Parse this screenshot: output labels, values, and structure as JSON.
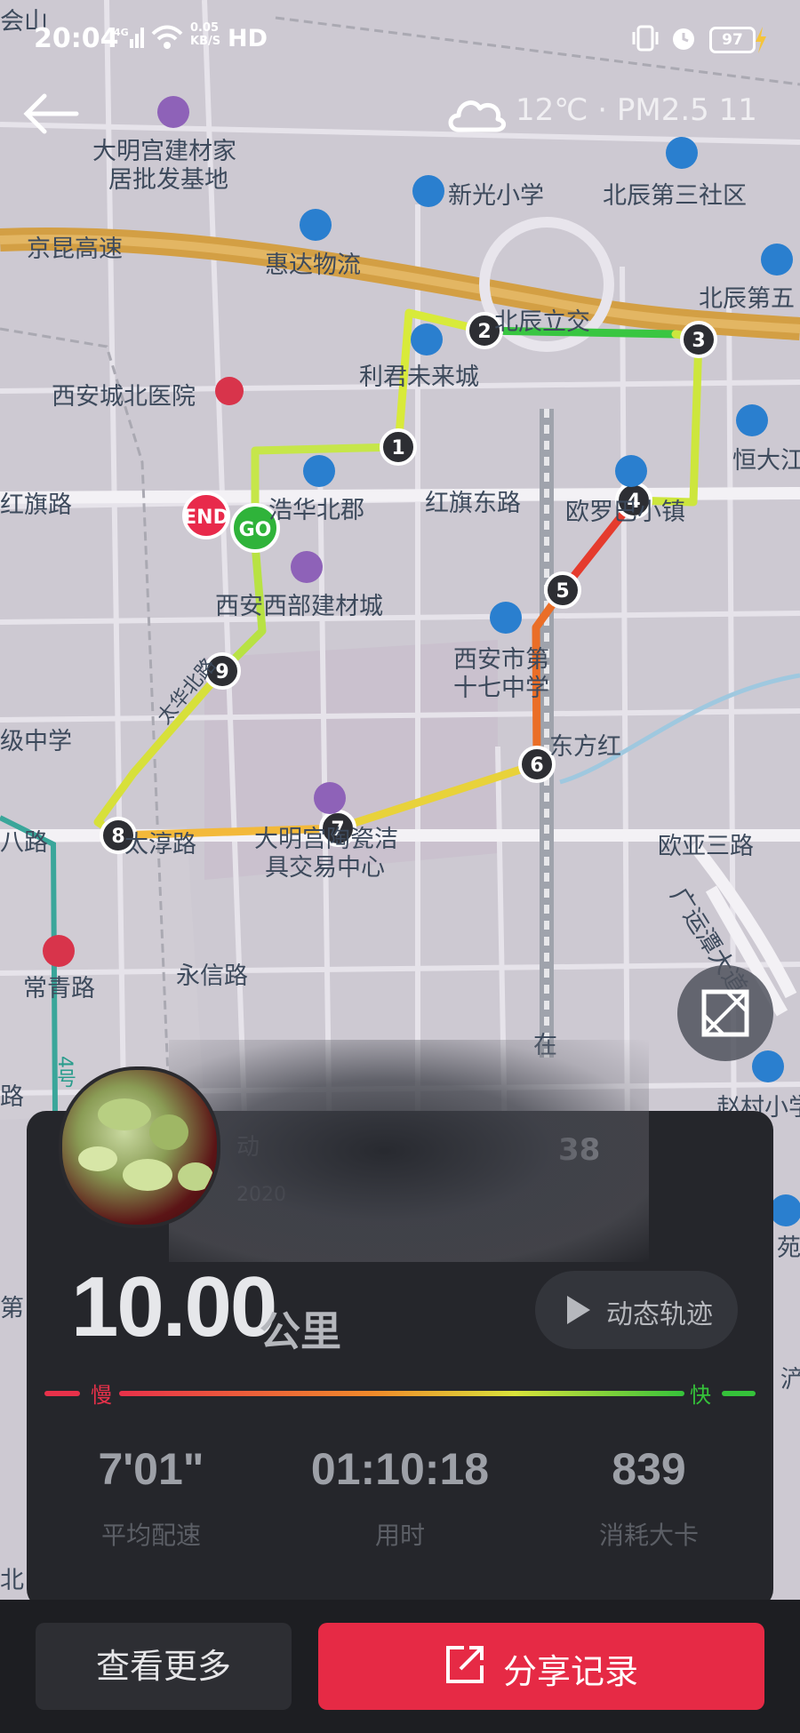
{
  "status_bar": {
    "time": "20:04",
    "network": "4G",
    "speed_value": "0.05",
    "speed_unit": "KB/S",
    "hd": "HD",
    "battery": "97"
  },
  "weather": {
    "text": "12℃ · PM2.5 11",
    "icon": "cloud-icon"
  },
  "map": {
    "labels": [
      {
        "id": "huishan",
        "text": "会山"
      },
      {
        "id": "daminggong-building",
        "text": "大明宫建材家"
      },
      {
        "id": "daminggong-building-2",
        "text": "居批发基地"
      },
      {
        "id": "xinguang",
        "text": "新光小学"
      },
      {
        "id": "beichen3",
        "text": "北辰第三社区"
      },
      {
        "id": "jingkun",
        "text": "京昆高速"
      },
      {
        "id": "huida",
        "text": "惠达物流"
      },
      {
        "id": "beichen5",
        "text": "北辰第五"
      },
      {
        "id": "beichen-interchange",
        "text": "北辰立交"
      },
      {
        "id": "xian-north-hospital",
        "text": "西安城北医院"
      },
      {
        "id": "lijun",
        "text": "利君未来城"
      },
      {
        "id": "hengda",
        "text": "恒大江湾"
      },
      {
        "id": "hongqi-road",
        "text": "红旗路"
      },
      {
        "id": "haohua",
        "text": "浩华北郡"
      },
      {
        "id": "hongqi-east",
        "text": "红旗东路"
      },
      {
        "id": "ouluo",
        "text": "欧罗巴小镇"
      },
      {
        "id": "west-building",
        "text": "西安西部建材城"
      },
      {
        "id": "school-17a",
        "text": "西安市第"
      },
      {
        "id": "school-17b",
        "text": "十七中学"
      },
      {
        "id": "middle-school",
        "text": "级中学"
      },
      {
        "id": "dongfanghong",
        "text": "东方红"
      },
      {
        "id": "road-ba",
        "text": "八路"
      },
      {
        "id": "road-chun",
        "text": "太淳路"
      },
      {
        "id": "daming-clean-a",
        "text": "大明宫陶瓷洁"
      },
      {
        "id": "daming-clean-b",
        "text": "具交易中心"
      },
      {
        "id": "ouya",
        "text": "欧亚三路"
      },
      {
        "id": "guangyun",
        "text": "广运潭大道"
      },
      {
        "id": "changqing",
        "text": "常青路"
      },
      {
        "id": "yongxin",
        "text": "永信路"
      },
      {
        "id": "road-lu",
        "text": "路"
      },
      {
        "id": "line4",
        "text": "4号"
      },
      {
        "id": "zhaocun",
        "text": "赵村小学"
      },
      {
        "id": "diyi",
        "text": "第"
      },
      {
        "id": "bei",
        "text": "北"
      },
      {
        "id": "yuan",
        "text": "苑"
      },
      {
        "id": "zhan",
        "text": "在"
      },
      {
        "id": "chan",
        "text": "浐"
      },
      {
        "id": "taihua",
        "text": "太华北路"
      }
    ],
    "route_markers": [
      "1",
      "2",
      "3",
      "4",
      "5",
      "6",
      "7",
      "8",
      "9"
    ],
    "start_label": "GO",
    "end_label": "END"
  },
  "user": {
    "name_partial": "动",
    "date_partial": "2020",
    "suffix": "38"
  },
  "summary": {
    "distance": "10.00",
    "distance_unit": "公里",
    "replay_label": "动态轨迹"
  },
  "legend": {
    "slow": "慢",
    "fast": "快",
    "slow_color": "#e8314a",
    "fast_color": "#35c23a"
  },
  "stats": [
    {
      "value": "7'01\"",
      "label": "平均配速"
    },
    {
      "value": "01:10:18",
      "label": "用时"
    },
    {
      "value": "839",
      "label": "消耗大卡"
    }
  ],
  "actions": {
    "more": "查看更多",
    "share": "分享记录"
  }
}
